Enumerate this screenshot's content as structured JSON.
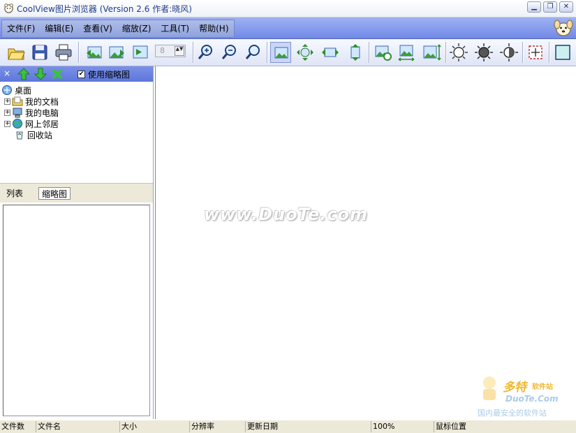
{
  "window": {
    "title": "CoolView图片浏览器 (Version 2.6  作者:晓风)",
    "minimize": "▁",
    "restore": "❐",
    "close": "✕"
  },
  "menu": {
    "items": [
      "文件(F)",
      "编辑(E)",
      "查看(V)",
      "缩放(Z)",
      "工具(T)",
      "帮助(H)"
    ]
  },
  "toolbar": {
    "zoom_value": "8",
    "spin_glyph": "▲▼"
  },
  "panel": {
    "close_glyph": "×",
    "thumbnail_checkbox_label": "使用缩略图",
    "thumbnail_checkbox_checked": true,
    "check_glyph": "✔"
  },
  "tree": {
    "expand_glyph": "+",
    "items": [
      {
        "label": "桌面",
        "icon": "desktop-icon",
        "expandable": false
      },
      {
        "label": "我的文档",
        "icon": "documents-folder-icon",
        "expandable": true
      },
      {
        "label": "我的电脑",
        "icon": "computer-icon",
        "expandable": true
      },
      {
        "label": "网上邻居",
        "icon": "network-icon",
        "expandable": true
      },
      {
        "label": "回收站",
        "icon": "recycle-bin-icon",
        "expandable": false
      }
    ]
  },
  "tabs": [
    {
      "label": "列表",
      "active": false
    },
    {
      "label": "缩略图",
      "active": true
    }
  ],
  "watermark": "www.DuoTe.com",
  "corner_logo": {
    "brand": "多特",
    "sub": "软件站",
    "site": "DuoTe.Com",
    "slogan": "国内最安全的软件站"
  },
  "statusbar": {
    "cells": [
      "文件数",
      "文件名",
      "大小",
      "分辨率",
      "更新日期",
      "100%",
      "鼠标位置"
    ]
  },
  "colors": {
    "menubar": "#7f95e8",
    "panel_header": "#6a82e0",
    "statusbar": "#ece9d8"
  }
}
